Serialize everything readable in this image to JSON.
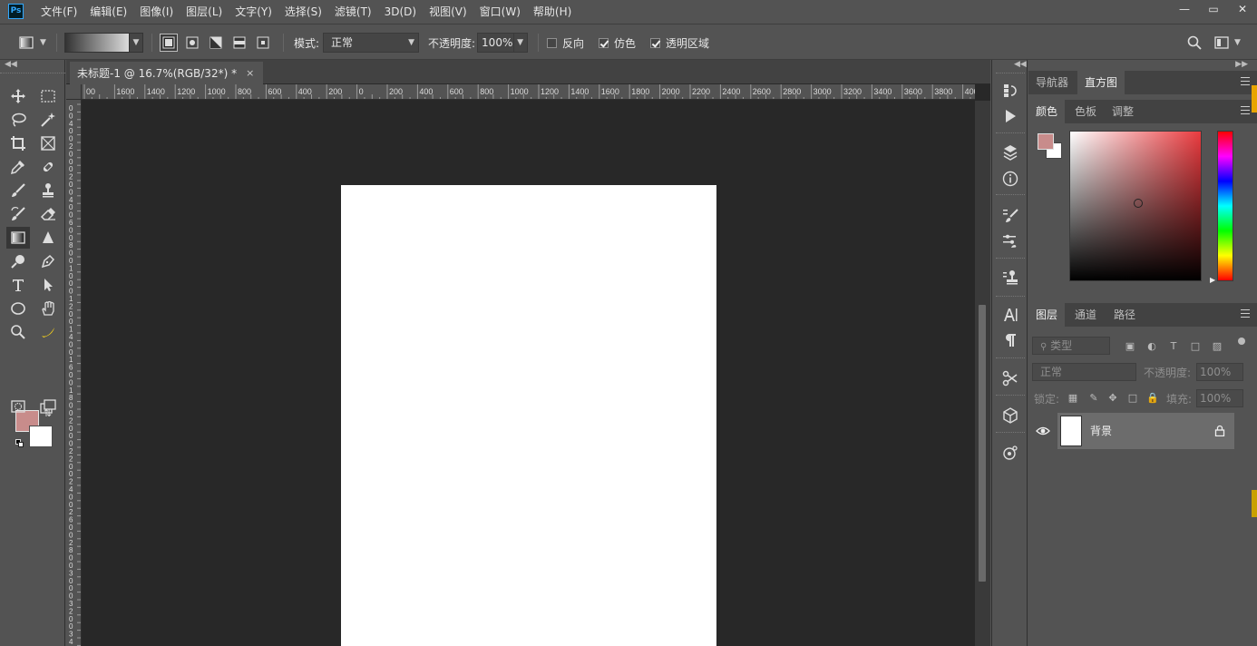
{
  "app": {
    "logo": "Ps"
  },
  "menu": [
    "文件(F)",
    "编辑(E)",
    "图像(I)",
    "图层(L)",
    "文字(Y)",
    "选择(S)",
    "滤镜(T)",
    "3D(D)",
    "视图(V)",
    "窗口(W)",
    "帮助(H)"
  ],
  "window_controls": {
    "minimize": "—",
    "restore": "▭",
    "close": "✕"
  },
  "options": {
    "mode_label": "模式:",
    "mode_value": "正常",
    "opacity_label": "不透明度:",
    "opacity_value": "100%",
    "reverse_label": "反向",
    "reverse_checked": false,
    "dither_label": "仿色",
    "dither_checked": true,
    "transparency_label": "透明区域",
    "transparency_checked": true
  },
  "document": {
    "tab_title": "未标题-1 @ 16.7%(RGB/32*) *",
    "close_glyph": "×",
    "ruler_h_labels": [
      "00",
      "1600",
      "1400",
      "1200",
      "1000",
      "800",
      "600",
      "400",
      "200",
      "0",
      "200",
      "400",
      "600",
      "800",
      "1000",
      "1200",
      "1400",
      "1600",
      "1800",
      "2000",
      "2200",
      "2400",
      "2600",
      "2800",
      "3000",
      "3200",
      "3400",
      "3600",
      "3800",
      "4000"
    ],
    "ruler_v_labels": [
      "0",
      "0",
      "4",
      "0",
      "0",
      "2",
      "0",
      "0",
      "0",
      "2",
      "0",
      "0",
      "4",
      "0",
      "0",
      "6",
      "0",
      "0",
      "8",
      "0",
      "0",
      "1",
      "0",
      "0",
      "0",
      "1",
      "2",
      "0",
      "0",
      "1",
      "4",
      "0",
      "0",
      "1",
      "6",
      "0",
      "0",
      "1",
      "8",
      "0",
      "0",
      "2",
      "0",
      "0",
      "0",
      "2",
      "2",
      "0",
      "0",
      "2",
      "4",
      "0",
      "0",
      "2",
      "6",
      "0",
      "0",
      "2",
      "8",
      "0",
      "0",
      "3",
      "0",
      "0",
      "0",
      "3",
      "2",
      "0",
      "0",
      "3",
      "4",
      "0"
    ]
  },
  "panels": {
    "top_tabs": [
      "导航器",
      "直方图"
    ],
    "top_active": "直方图",
    "color_tabs": [
      "颜色",
      "色板",
      "调整"
    ],
    "color_active": "颜色",
    "fg_color": "#c88c8b",
    "bg_color": "#ffffff",
    "layer_tabs": [
      "图层",
      "通道",
      "路径"
    ],
    "layer_active": "图层",
    "layer_filter_placeholder": "类型",
    "blend_mode": "正常",
    "opacity_label": "不透明度:",
    "opacity_value": "100%",
    "lock_label": "锁定:",
    "fill_label": "填充:",
    "fill_value": "100%",
    "layers": [
      {
        "name": "背景",
        "visible": true,
        "locked": true
      }
    ]
  },
  "colors": {
    "workspace": "#535353",
    "canvas_bg": "#282828",
    "accent_ps": "#31a8ff"
  }
}
